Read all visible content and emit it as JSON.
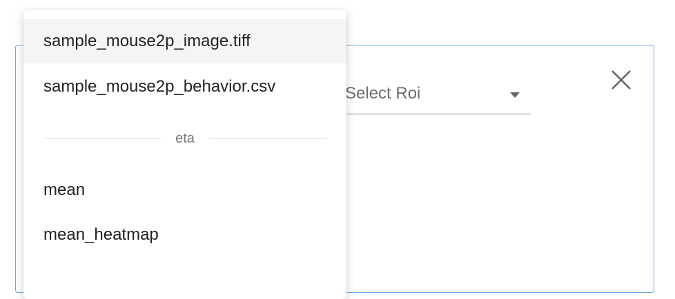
{
  "panel": {
    "roi_select": {
      "placeholder": "Select Roi"
    },
    "close_icon": "close-icon"
  },
  "dropdown": {
    "items": [
      {
        "label": "sample_mouse2p_image.tiff",
        "highlighted": true
      },
      {
        "label": "sample_mouse2p_behavior.csv"
      }
    ],
    "group": {
      "label": "eta",
      "items": [
        {
          "label": "mean"
        },
        {
          "label": "mean_heatmap"
        }
      ]
    }
  },
  "colors": {
    "accent_border": "#6aa8ea",
    "highlight": "#f5f5f5"
  }
}
